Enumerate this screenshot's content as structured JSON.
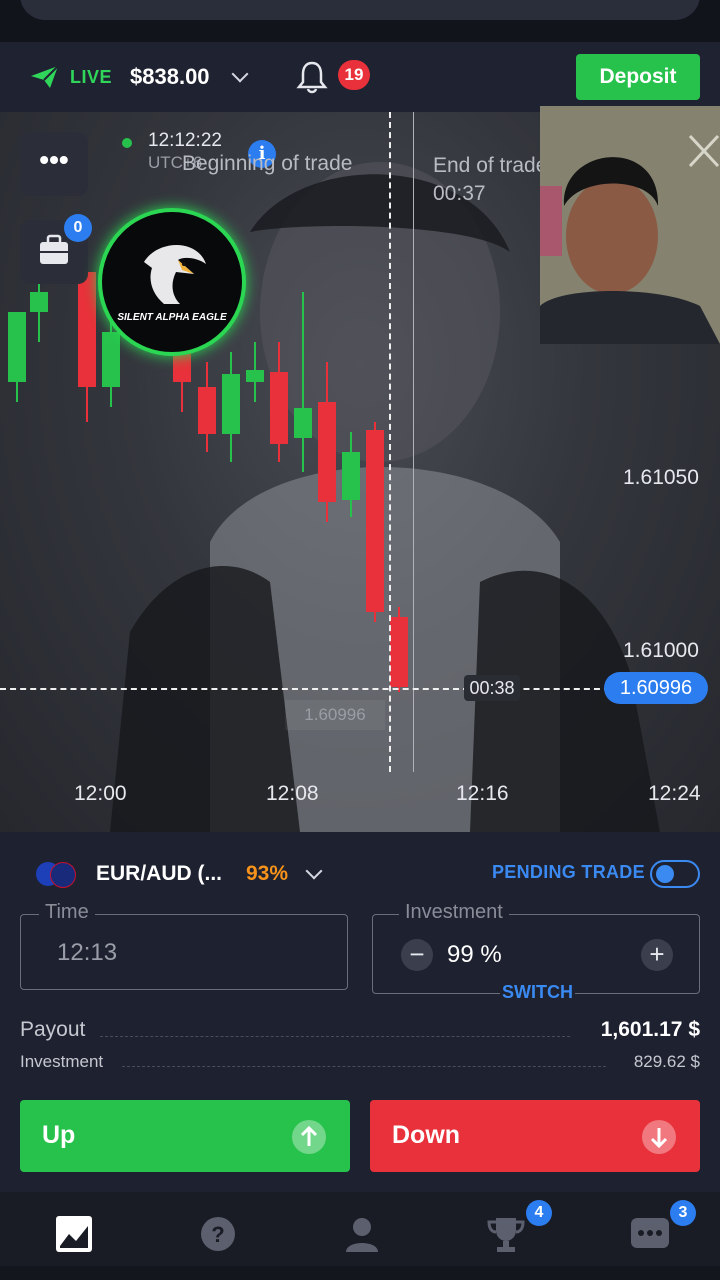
{
  "header": {
    "mode_label": "LIVE",
    "balance": "$838.00",
    "notifications_count": "19",
    "deposit_label": "Deposit"
  },
  "chart": {
    "clock_time": "12:12:22",
    "clock_tz": "UTC+6",
    "portfolio_count": "0",
    "beginning_label": "Beginning of trade",
    "end_label": "End of trade",
    "end_countdown": "00:37",
    "timer": "00:38",
    "current_price": "1.60996",
    "ghost_price": "1.60996",
    "logo_text": "SILENT ALPHA EAGLE",
    "x_ticks": [
      "12:00",
      "12:08",
      "12:16",
      "12:24"
    ],
    "y_ticks": [
      "1.61050",
      "1.61000"
    ]
  },
  "chart_data": {
    "type": "candlestick",
    "title": "",
    "xlabel": "",
    "ylabel": "",
    "x_ticks": [
      "12:00",
      "12:08",
      "12:16",
      "12:24"
    ],
    "y_ticks": [
      1.6105,
      1.61
    ],
    "current_price": 1.60996,
    "candles": [
      {
        "dir": "up"
      },
      {
        "dir": "up"
      },
      {
        "dir": "down"
      },
      {
        "dir": "up"
      },
      {
        "dir": "down"
      },
      {
        "dir": "down"
      },
      {
        "dir": "up"
      },
      {
        "dir": "up"
      },
      {
        "dir": "down"
      },
      {
        "dir": "up"
      },
      {
        "dir": "down"
      },
      {
        "dir": "up"
      },
      {
        "dir": "down"
      },
      {
        "dir": "down"
      }
    ]
  },
  "trade": {
    "asset": "EUR/AUD (...",
    "payout_pct": "93%",
    "pending_label": "PENDING TRADE",
    "time_label": "Time",
    "time_value": "12:13",
    "investment_label": "Investment",
    "investment_value": "99 %",
    "switch_label": "SWITCH",
    "payout_label": "Payout",
    "payout_value": "1,601.17 $",
    "investment_row_label": "Investment",
    "investment_row_value": "829.62 $",
    "up_label": "Up",
    "down_label": "Down"
  },
  "nav": {
    "trophy_badge": "4",
    "chat_badge": "3"
  },
  "colors": {
    "green": "#27c24c",
    "red": "#e8313a",
    "blue": "#2b7df0",
    "orange": "#f7931a"
  }
}
